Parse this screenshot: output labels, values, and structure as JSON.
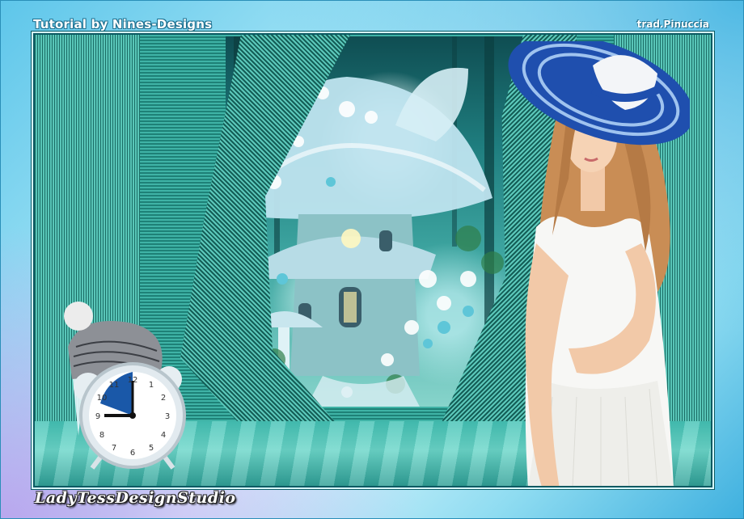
{
  "header": {
    "tutorial_credit": "Tutorial by Nines-Designs",
    "translator_credit": "trad.Pinuccia"
  },
  "footer": {
    "signature": "LadyTessDesignStudio"
  },
  "colors": {
    "frame_accent": "#5ec6ea",
    "teal_main": "#3fb3a6",
    "teal_dark": "#1e8177",
    "border_dark": "#0b5a62",
    "hat_blue": "#1f4fae"
  },
  "clock": {
    "numerals": [
      "12",
      "1",
      "2",
      "3",
      "4",
      "5",
      "6",
      "7",
      "8",
      "9",
      "10",
      "11"
    ]
  },
  "icons": [
    "clock-icon",
    "knit-hat-icon"
  ]
}
